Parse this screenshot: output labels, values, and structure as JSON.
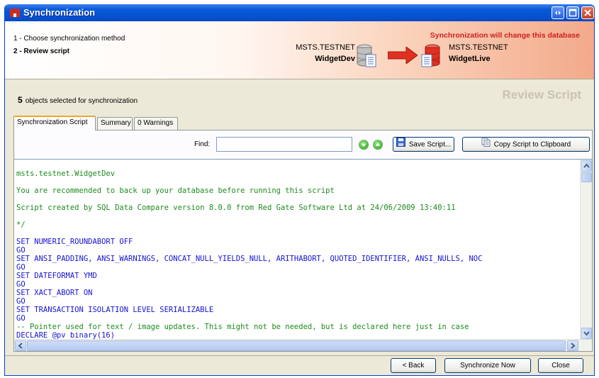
{
  "window": {
    "title": "Synchronization",
    "controls": [
      "restore-icon",
      "maximize-icon",
      "close-icon"
    ]
  },
  "header": {
    "steps": [
      {
        "label": "1 - Choose synchronization method",
        "active": false
      },
      {
        "label": "2 - Review script",
        "active": true
      }
    ],
    "warning": "Synchronization will change this database",
    "source": {
      "server": "MSTS.TESTNET",
      "database": "WidgetDev"
    },
    "target": {
      "server": "MSTS.TESTNET",
      "database": "WidgetLive"
    },
    "colors": {
      "warning": "#d11e1e",
      "header_gradient_end": "#f3a98a"
    }
  },
  "summary": {
    "count": "5",
    "text": "objects selected for synchronization",
    "page_title": "Review Script"
  },
  "tabs": [
    {
      "label": "Synchronization Script",
      "active": true
    },
    {
      "label": "Summary",
      "active": false
    },
    {
      "label": "0 Warnings",
      "active": false
    }
  ],
  "toolbar": {
    "find_label": "Find:",
    "find_value": "",
    "next_icon": "arrow-down-icon",
    "prev_icon": "arrow-up-icon",
    "save_label": "Save Script...",
    "copy_label": "Copy Script to Clipboard"
  },
  "script": {
    "lines": [
      {
        "t": "msts.testnet.WidgetDev",
        "c": "cm"
      },
      {
        "t": "You are recommended to back up your database before running this script",
        "c": "cm"
      },
      {
        "t": "Script created by SQL Data Compare version 8.0.0 from Red Gate Software Ltd at 24/06/2009 13:40:11",
        "c": "cm"
      },
      {
        "t": "*/",
        "c": "cm"
      },
      {
        "t": "SET NUMERIC_ROUNDABORT OFF",
        "c": "kw"
      },
      {
        "t": "GO",
        "c": "kw"
      },
      {
        "t": "SET ANSI_PADDING, ANSI_WARNINGS, CONCAT_NULL_YIELDS_NULL, ARITHABORT, QUOTED_IDENTIFIER, ANSI_NULLS, NOC",
        "c": "kw"
      },
      {
        "t": "GO",
        "c": "kw"
      },
      {
        "t": "SET DATEFORMAT YMD",
        "c": "kw"
      },
      {
        "t": "GO",
        "c": "kw"
      },
      {
        "t": "SET XACT_ABORT ON",
        "c": "kw"
      },
      {
        "t": "GO",
        "c": "kw"
      },
      {
        "t": "SET TRANSACTION ISOLATION LEVEL SERIALIZABLE",
        "c": "kw"
      },
      {
        "t": "GO",
        "c": "kw"
      },
      {
        "t": "-- Pointer used for text / image updates. This might not be needed, but is declared here just in case",
        "c": "cm"
      },
      {
        "t": "DECLARE @pv binary(16)",
        "c": "kw"
      }
    ]
  },
  "footer": {
    "back_label": "< Back",
    "sync_label": "Synchronize Now",
    "close_label": "Close"
  }
}
